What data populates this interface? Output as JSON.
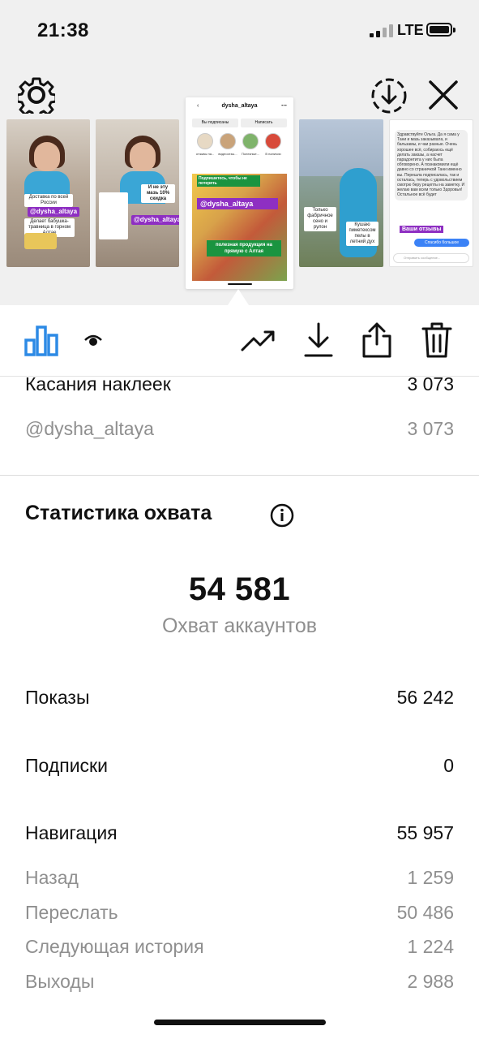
{
  "status_bar": {
    "time": "21:38",
    "network": "LTE"
  },
  "thumbnails": {
    "t1": {
      "caption": "Доставка по всей России",
      "sub": "Делает бабушка-травница в горном Алтае",
      "tag": "@dysha_altaya"
    },
    "t2": {
      "caption": "И не эту мазь 10% скидка",
      "tag": "@dysha_altaya"
    },
    "t3": {
      "username": "dysha_altaya",
      "follow_btn": "Вы подписаны",
      "message_btn": "Написать",
      "highlights": [
        "отзывы на...",
        "видеоотзы...",
        "Полезные...",
        "В наличии"
      ],
      "banner1": "Подпишитесь, чтобы не потерять",
      "tag": "@dysha_altaya",
      "banner2": "полезная продукция на прямую с Алтая"
    },
    "t4": {
      "caption1": "Только фабричное сено и рулон",
      "caption2": "Кушаю пиметексом пелы в летний дух"
    },
    "t5": {
      "message": "Здравствуйте Ольга. Да я сама у Тани и мазь заказывала, и бальзамы, и чаи разные. Очень хорошее всё, собираюсь ещё делать заказы, а насчет парадонтита у них была обговорено. А познакомили ещё давно со страничкой Тани именно вы. Перешла подписалась, так и осталась, теперь с удовольствием смотрю беру рецепты на заметку. И желаю вам всем только Здоровья! Остальное всё будет",
      "badge": "Ваши отзывы",
      "reply": "Спасибо большое",
      "input_placeholder": "Отправить сообщение..."
    }
  },
  "stats": {
    "sticker_taps_label": "Касания наклеек",
    "sticker_taps_value": "3 073",
    "sticker_handle": "@dysha_altaya",
    "sticker_handle_value": "3 073",
    "reach_title": "Статистика охвата",
    "accounts_reached_value": "54 581",
    "accounts_reached_label": "Охват аккаунтов",
    "impressions_label": "Показы",
    "impressions_value": "56 242",
    "follows_label": "Подписки",
    "follows_value": "0",
    "navigation_label": "Навигация",
    "navigation_value": "55 957",
    "back_label": "Назад",
    "back_value": "1 259",
    "forward_label": "Переслать",
    "forward_value": "50 486",
    "next_story_label": "Следующая история",
    "next_story_value": "1 224",
    "exits_label": "Выходы",
    "exits_value": "2 988"
  },
  "colors": {
    "accent": "#2d8ae5",
    "story_tag": "#8e2fc2",
    "story_green": "#1a9440"
  }
}
